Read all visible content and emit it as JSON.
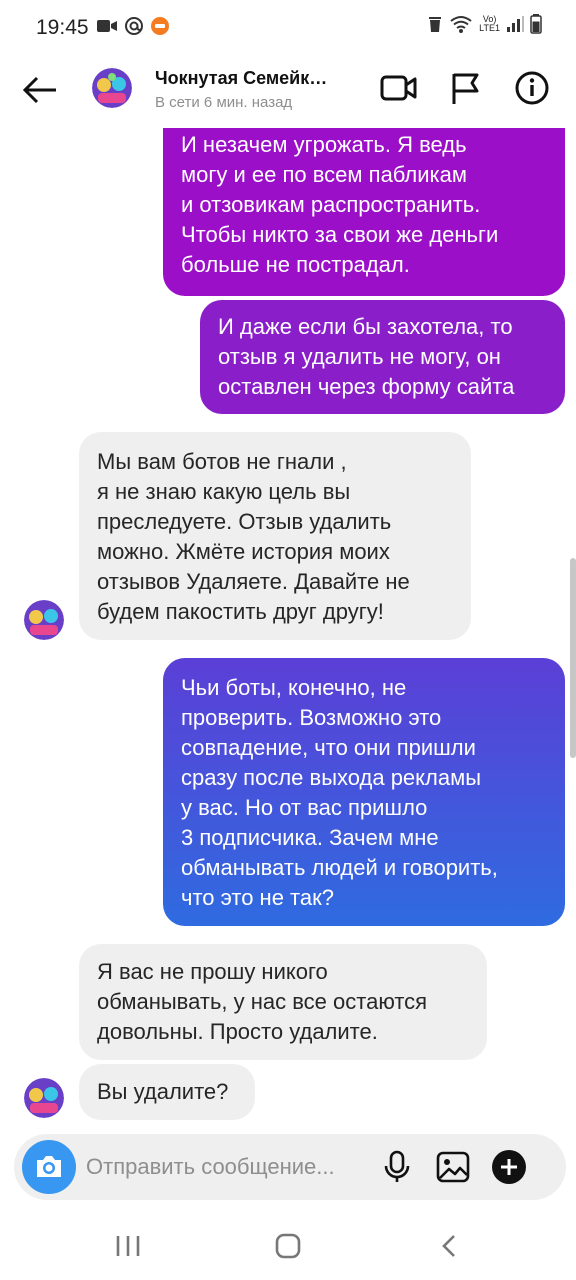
{
  "status_bar": {
    "time": "19:45",
    "network_label_top": "Vo)",
    "network_label_bottom": "LTE1",
    "battery_percent": 70
  },
  "header": {
    "title": "Чокнутая Семейк…",
    "subtitle": "В сети 6 мин. назад",
    "icons": [
      "back-arrow-icon",
      "video-call-icon",
      "flag-icon",
      "info-icon"
    ]
  },
  "messages": [
    {
      "direction": "outgoing",
      "text": "И незачем угрожать. Я ведь\nмогу и ее  по всем пабликам\nи отзовикам распространить.\nЧтобы никто за свои же деньги\nбольше не пострадал."
    },
    {
      "direction": "outgoing",
      "text": "И даже если бы захотела, то\nотзыв я удалить не могу, он\nоставлен через форму сайта"
    },
    {
      "direction": "incoming",
      "text": "Мы вам ботов не гнали ,\nя не знаю какую цель вы\nпреследуете. Отзыв удалить\nможно. Жмёте история моих\nотзывов Удаляете. Давайте не\nбудем пакостить друг другу!"
    },
    {
      "direction": "outgoing",
      "text": "Чьи боты, конечно, не\nпроверить. Возможно это\nсовпадение, что они пришли\nсразу после выхода рекламы\nу вас. Но от вас пришло\n3 подписчика. Зачем мне\nобманывать людей и говорить,\nчто это не так?"
    },
    {
      "direction": "incoming",
      "text": "Я вас не прошу никого\nобманывать, у нас все остаются\nдовольны. Просто удалите."
    },
    {
      "direction": "incoming",
      "text": "Вы удалите?"
    }
  ],
  "composer": {
    "placeholder": "Отправить сообщение...",
    "icons": [
      "camera-icon",
      "microphone-icon",
      "gallery-icon",
      "add-icon"
    ]
  },
  "colors": {
    "out_purple": "#9c0fc8",
    "out_violet": "#8a1fc9",
    "out_blue_top": "#5b3fd6",
    "out_blue_bottom": "#2f6be0",
    "incoming_bg": "#efefef",
    "camera_blue": "#3897f0"
  }
}
